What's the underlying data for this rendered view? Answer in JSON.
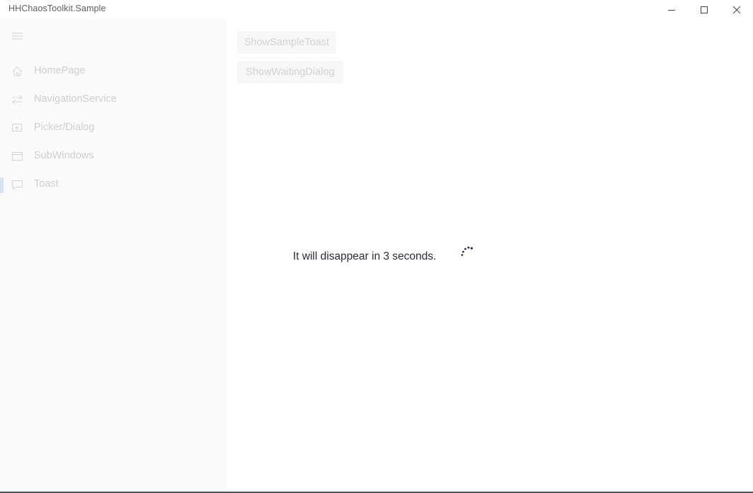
{
  "window": {
    "title": "HHChaosToolkit.Sample"
  },
  "caption_buttons": {
    "minimize_icon": "minimize-icon",
    "maximize_icon": "maximize-icon",
    "close_icon": "close-icon"
  },
  "sidebar": {
    "menu_icon": "hamburger-icon",
    "items": [
      {
        "label": "HomePage",
        "icon": "home-icon",
        "selected": false
      },
      {
        "label": "NavigationService",
        "icon": "swap-arrows-icon",
        "selected": false
      },
      {
        "label": "Picker/Dialog",
        "icon": "picker-dialog-icon",
        "selected": false
      },
      {
        "label": "SubWindows",
        "icon": "window-icon",
        "selected": false
      },
      {
        "label": "Toast",
        "icon": "chat-bubble-icon",
        "selected": true
      }
    ]
  },
  "main": {
    "buttons": {
      "show_sample_toast": "ShowSampleToast",
      "show_waiting_dialog": "ShowWaitingDialog"
    },
    "waiting_message": "It will disappear in 3 seconds.",
    "spinner_icon": "loading-spinner-icon"
  },
  "colors": {
    "sidebar_bg": "#fafafa",
    "nav_text_disabled": "#cfcfcf",
    "selection_indicator": "#d7e3f0",
    "message_text": "#2b2b3a",
    "spinner": "#2b2b4a"
  }
}
